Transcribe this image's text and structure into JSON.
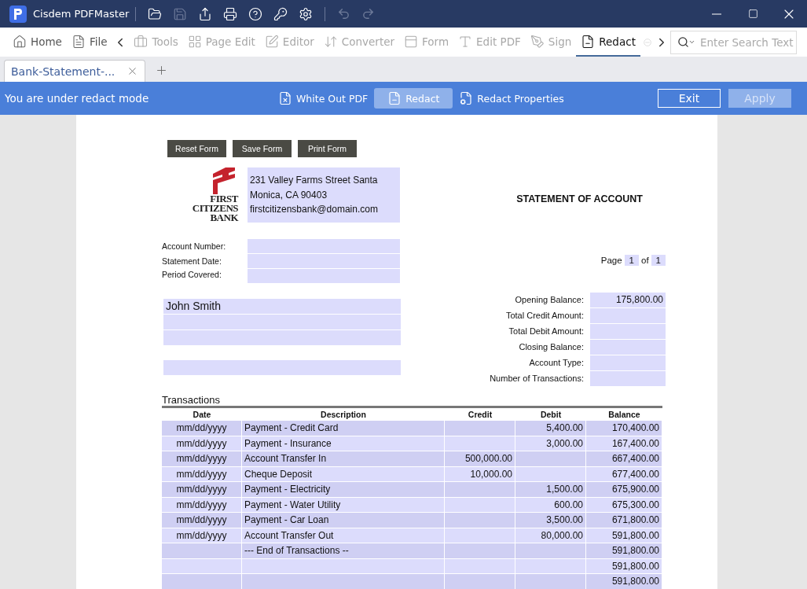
{
  "window": {
    "app_name": "Cisdem PDFMaster"
  },
  "toolbar": {
    "items": [
      {
        "label": "Home",
        "disabled": false,
        "selected": false
      },
      {
        "label": "File",
        "disabled": false,
        "selected": false
      },
      {
        "label": "Tools",
        "disabled": true,
        "selected": false
      },
      {
        "label": "Page Edit",
        "disabled": true,
        "selected": false
      },
      {
        "label": "Editor",
        "disabled": true,
        "selected": false
      },
      {
        "label": "Converter",
        "disabled": true,
        "selected": false
      },
      {
        "label": "Form",
        "disabled": true,
        "selected": false
      },
      {
        "label": "Edit PDF",
        "disabled": true,
        "selected": false
      },
      {
        "label": "Sign",
        "disabled": true,
        "selected": false
      },
      {
        "label": "Redact",
        "disabled": false,
        "selected": true
      }
    ],
    "search": {
      "placeholder": "Enter Search Text"
    }
  },
  "document_tabs": [
    {
      "label": "Bank-Statement-...",
      "selected": true
    }
  ],
  "redact_bar": {
    "status": "You are under redact mode",
    "actions": [
      {
        "label": "White Out PDF",
        "selected": false
      },
      {
        "label": "Redact",
        "selected": true
      },
      {
        "label": "Redact Properties",
        "selected": false
      }
    ],
    "buttons": [
      {
        "label": "Exit",
        "disabled": false
      },
      {
        "label": "Apply",
        "disabled": true
      }
    ]
  },
  "document": {
    "form_buttons": [
      "Reset Form",
      "Save Form",
      "Print Form"
    ],
    "logo": {
      "lines": [
        "FIRST",
        "CITIZENS",
        "BANK"
      ]
    },
    "address_lines": [
      "231 Valley Farms Street Santa",
      "Monica, CA 90403",
      "firstcitizensbank@domain.com"
    ],
    "title": "STATEMENT OF ACCOUNT",
    "account_fields": [
      {
        "label": "Account Number:"
      },
      {
        "label": "Statement Date:"
      },
      {
        "label": "Period Covered:"
      }
    ],
    "page_indicator": {
      "label": "Page",
      "current": "1",
      "separator": "of",
      "total": "1"
    },
    "name_fields": [
      {
        "value": "John Smith",
        "kind": "line"
      },
      {
        "kind": "line"
      },
      {
        "kind": "line"
      },
      {
        "kind": "separated"
      }
    ],
    "summary": [
      {
        "label": "Opening Balance:",
        "value": "175,800.00"
      },
      {
        "label": "Total Credit Amount:"
      },
      {
        "label": "Total Debit Amount:"
      },
      {
        "label": "Closing Balance:"
      },
      {
        "label": "Account Type:"
      },
      {
        "label": "Number of Transactions:"
      }
    ],
    "transactions": {
      "title": "Transactions",
      "columns": [
        "Date",
        "Description",
        "Credit",
        "Debit",
        "Balance"
      ],
      "rows": [
        {
          "date": "mm/dd/yyyy",
          "description": "Payment - Credit Card",
          "debit": "5,400.00",
          "balance": "170,400.00"
        },
        {
          "date": "mm/dd/yyyy",
          "description": "Payment - Insurance",
          "debit": "3,000.00",
          "balance": "167,400.00"
        },
        {
          "date": "mm/dd/yyyy",
          "description": "Account Transfer In",
          "credit": "500,000.00",
          "balance": "667,400.00"
        },
        {
          "date": "mm/dd/yyyy",
          "description": "Cheque Deposit",
          "credit": "10,000.00",
          "balance": "677,400.00"
        },
        {
          "date": "mm/dd/yyyy",
          "description": "Payment - Electricity",
          "debit": "1,500.00",
          "balance": "675,900.00"
        },
        {
          "date": "mm/dd/yyyy",
          "description": "Payment - Water Utility",
          "debit": "600.00",
          "balance": "675,300.00"
        },
        {
          "date": "mm/dd/yyyy",
          "description": "Payment - Car Loan",
          "debit": "3,500.00",
          "balance": "671,800.00"
        },
        {
          "date": "mm/dd/yyyy",
          "description": "Account Transfer Out",
          "debit": "80,000.00",
          "balance": "591,800.00"
        },
        {
          "description": "--- End of Transactions --",
          "balance": "591,800.00"
        },
        {
          "balance": "591,800.00"
        },
        {
          "balance": "591,800.00"
        }
      ]
    }
  }
}
